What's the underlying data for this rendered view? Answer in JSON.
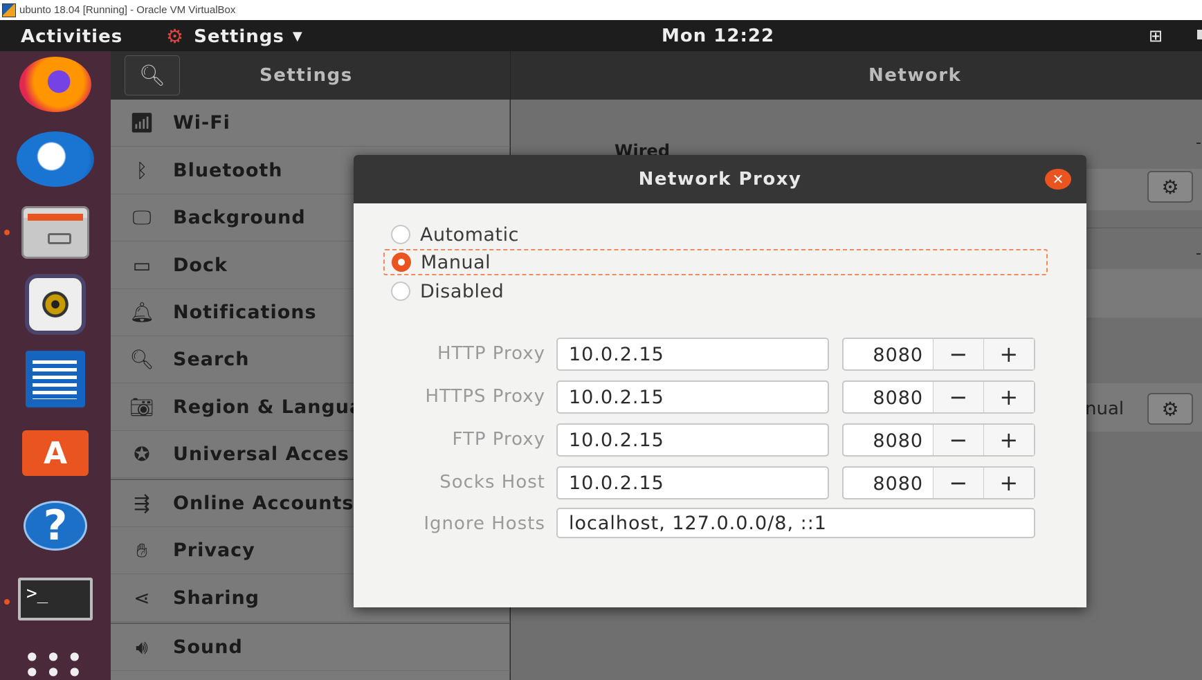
{
  "host": {
    "title": "ubunto 18.04 [Running] - Oracle VM VirtualBox"
  },
  "topbar": {
    "activities": "Activities",
    "app_menu": "Settings",
    "clock": "Mon 12:22"
  },
  "dock": {
    "items": [
      "firefox",
      "thunderbird",
      "files",
      "rhythmbox",
      "libreoffice-writer",
      "ubuntu-software",
      "help",
      "terminal",
      "show-applications"
    ]
  },
  "settings": {
    "header_title": "Settings",
    "panel_title": "Network",
    "sidebar": [
      {
        "label": "Wi-Fi",
        "icon": "wifi-icon"
      },
      {
        "label": "Bluetooth",
        "icon": "bluetooth-icon"
      },
      {
        "label": "Background",
        "icon": "background-icon"
      },
      {
        "label": "Dock",
        "icon": "dock-icon"
      },
      {
        "label": "Notifications",
        "icon": "bell-icon"
      },
      {
        "label": "Search",
        "icon": "search-icon"
      },
      {
        "label": "Region & Langua",
        "icon": "region-icon"
      },
      {
        "label": "Universal Acces",
        "icon": "accessibility-icon"
      },
      {
        "label": "Online Accounts",
        "icon": "online-accounts-icon"
      },
      {
        "label": "Privacy",
        "icon": "privacy-icon"
      },
      {
        "label": "Sharing",
        "icon": "share-icon"
      },
      {
        "label": "Sound",
        "icon": "speaker-icon"
      }
    ],
    "network": {
      "wired_heading": "Wired",
      "proxy_partial_value": "nual"
    }
  },
  "dialog": {
    "title": "Network Proxy",
    "methods": [
      {
        "label": "Automatic",
        "checked": false
      },
      {
        "label": "Manual",
        "checked": true
      },
      {
        "label": "Disabled",
        "checked": false
      }
    ],
    "proxies": [
      {
        "label": "HTTP Proxy",
        "host": "10.0.2.15",
        "port": "8080"
      },
      {
        "label": "HTTPS Proxy",
        "host": "10.0.2.15",
        "port": "8080"
      },
      {
        "label": "FTP Proxy",
        "host": "10.0.2.15",
        "port": "8080"
      },
      {
        "label": "Socks Host",
        "host": "10.0.2.15",
        "port": "8080"
      }
    ],
    "ignore_hosts": {
      "label": "Ignore Hosts",
      "value": "localhost, 127.0.0.0/8, ::1"
    },
    "spin_minus": "−",
    "spin_plus": "+"
  },
  "colors": {
    "accent": "#e95420",
    "dock_bg": "#4a2a3a",
    "topbar_bg": "#1d1d1d"
  }
}
